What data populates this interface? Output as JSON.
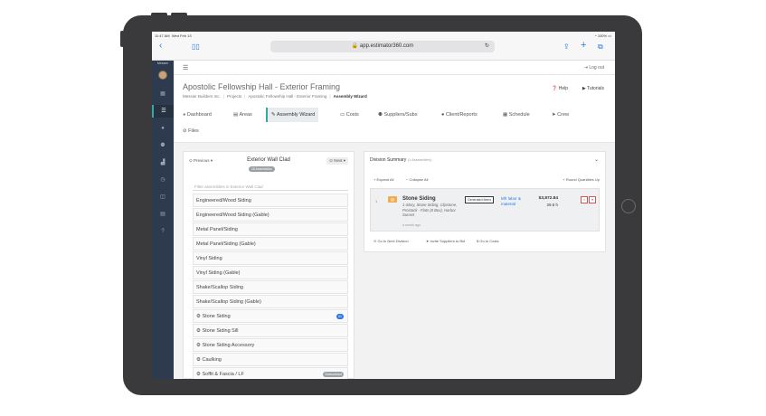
{
  "device": {
    "status_time": "11:47 AM",
    "status_date": "Wed Feb 13",
    "battery": "100%",
    "url": "app.estimator360.com"
  },
  "sidebar": {
    "brand": "Messier",
    "icons": [
      "grid-icon",
      "list-icon",
      "person-icon",
      "people-icon",
      "chart-icon",
      "clock-icon",
      "chat-icon",
      "calendar-icon",
      "help-icon"
    ]
  },
  "topbar": {
    "logout": "Log out"
  },
  "header": {
    "project_title": "Apostolic Fellowship Hall - Exterior Framing",
    "breadcrumbs": [
      "Messier Builders Inc.",
      "Projects",
      "Apostolic Fellowship Hall - Exterior Framing",
      "Assembly Wizard"
    ],
    "help": "Help",
    "tutorials": "Tutorials"
  },
  "tabs": [
    {
      "label": "Dashboard",
      "icon": "dashboard-icon"
    },
    {
      "label": "Areas",
      "icon": "areas-icon"
    },
    {
      "label": "Assembly Wizard",
      "icon": "pencil-icon",
      "active": true
    },
    {
      "label": "Costs",
      "icon": "costs-icon"
    },
    {
      "label": "Suppliers/Subs",
      "icon": "suppliers-icon"
    },
    {
      "label": "Client/Reports",
      "icon": "client-icon"
    },
    {
      "label": "Schedule",
      "icon": "calendar-icon"
    },
    {
      "label": "Crew",
      "icon": "crew-icon"
    },
    {
      "label": "Files",
      "icon": "files-icon"
    }
  ],
  "left_panel": {
    "previous": "Previous",
    "next": "Next",
    "title": "Exterior Wall Clad",
    "count_badge": "16 Assemblies",
    "filter_placeholder": "Filter assemblies in Exterior Wall Clad",
    "items": [
      {
        "label": "Engineered/Wood Siding"
      },
      {
        "label": "Engineered/Wood Siding (Gable)"
      },
      {
        "label": "Metal Panel/Siding"
      },
      {
        "label": "Metal Panel/Siding (Gable)"
      },
      {
        "label": "Vinyl Siding"
      },
      {
        "label": "Vinyl Siding (Gable)"
      },
      {
        "label": "Shake/Scallop Siding"
      },
      {
        "label": "Shake/Scallop Siding (Gable)"
      },
      {
        "label": "Stone Siding",
        "badge": "#1"
      },
      {
        "label": "Stone Siding Sill"
      },
      {
        "label": "Stone Siding Accessory"
      },
      {
        "label": "Caulking"
      },
      {
        "label": "Soffit & Fascia / LF",
        "badge": "Subcontract",
        "badge_gray": true
      }
    ]
  },
  "right_panel": {
    "title": "Division Summary",
    "title_count": "(1 Assemblies)",
    "expand_all": "Expand All",
    "collapse_all": "Collapse All",
    "round_quantities": "Round Quantities Up",
    "item": {
      "number": "1",
      "name": "Stone Siding",
      "description": "1-Story, Stone Siding, Clipstone, Prostack - Flats (8 Box), Harbor Sunset",
      "age": "a month ago",
      "generated_tag": "Generated Items",
      "link": "Mfr labor & material",
      "price": "$3,872.84",
      "hours": "29.5 h"
    },
    "footer_links": [
      "Go to Next Division",
      "Invite Suppliers to Bid",
      "Go to Costs"
    ]
  },
  "colors": {
    "sidebar_bg": "#2e3b4e",
    "accent_teal": "#3aa6a0",
    "link_blue": "#2a7ae2",
    "danger": "#d9534f",
    "warning": "#f0ad4e"
  }
}
